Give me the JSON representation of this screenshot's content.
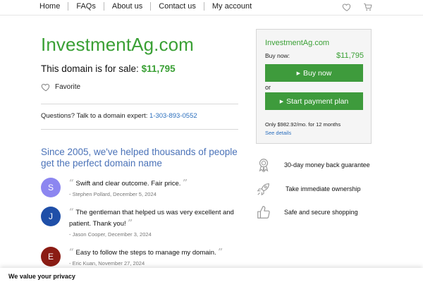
{
  "nav": {
    "links": [
      "Home",
      "FAQs",
      "About us",
      "Contact us",
      "My account"
    ]
  },
  "icons": {
    "favorite": "heart-icon",
    "cart": "cart-icon"
  },
  "colors": {
    "brand_green": "#3aa035",
    "button_green": "#3e9b3c",
    "link_blue": "#2a6ebd",
    "heading_blue": "#4a72b8"
  },
  "domain": {
    "name": "InvestmentAg.com",
    "sale_prefix": "This domain is for sale: ",
    "price": "$11,795",
    "favorite_label": "Favorite"
  },
  "contact": {
    "prompt": "Questions? Talk to a domain expert: ",
    "phone": "1-303-893-0552"
  },
  "testimonials": {
    "heading": "Since 2005, we've helped thousands of people get the perfect domain name",
    "reviews": [
      {
        "initial": "S",
        "color": "#8c86f0",
        "quote": "Swift and clear outcome. Fair price.",
        "meta": "- Stephen Pollard, December 5, 2024"
      },
      {
        "initial": "J",
        "color": "#1f4fa8",
        "quote": "The gentleman that helped us was very excellent and patient. Thank you!",
        "meta": "- Jason Cooper, December 3, 2024"
      },
      {
        "initial": "E",
        "color": "#8b1c14",
        "quote": "Easy to follow the steps to manage my domain.",
        "meta": "- Eric Kuan, November 27, 2024"
      }
    ]
  },
  "buybox": {
    "title": "InvestmentAg.com",
    "buy_now_label": "Buy now:",
    "price": "$11,795",
    "buy_button": "Buy now",
    "or": "or",
    "plan_button": "Start payment plan",
    "monthly": "Only $982.92/mo. for 12 months",
    "see_details": "See details"
  },
  "features": [
    {
      "icon": "award-ribbon-icon",
      "text": "30-day money back guarantee"
    },
    {
      "icon": "rocket-icon",
      "text": "Take immediate ownership"
    },
    {
      "icon": "thumbs-up-icon",
      "text": "Safe and secure shopping"
    }
  ],
  "privacy": {
    "title": "We value your privacy"
  }
}
